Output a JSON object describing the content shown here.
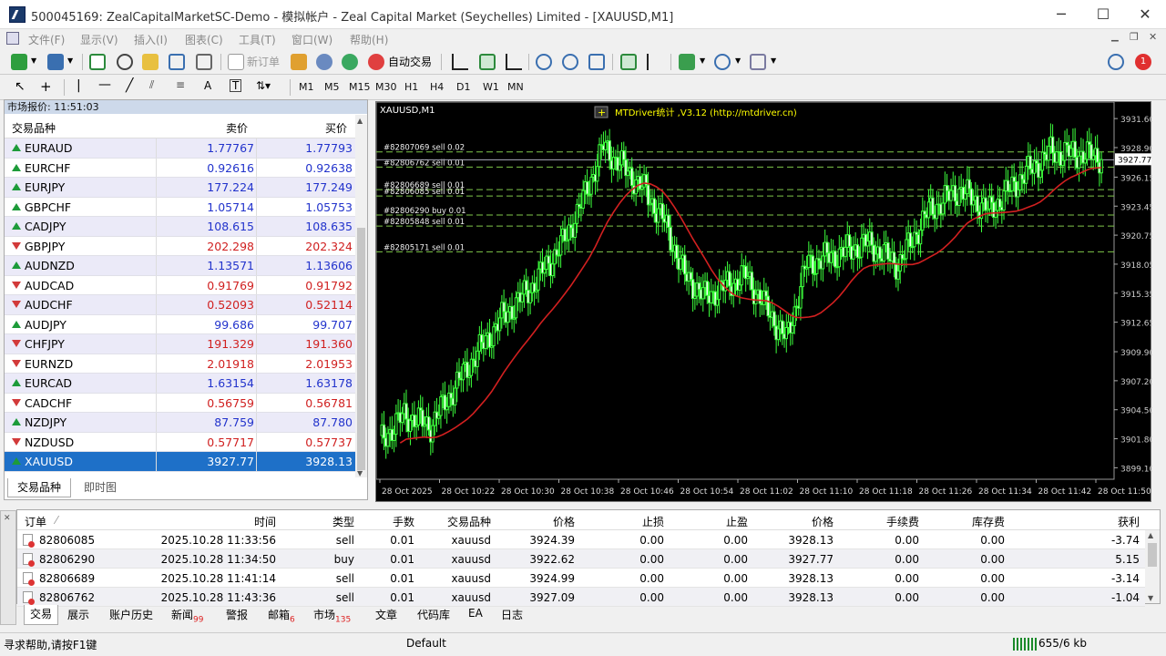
{
  "window": {
    "title": "500045169: ZealCapitalMarketSC-Demo - 模拟帐户 - Zeal Capital Market (Seychelles) Limited - [XAUUSD,M1]"
  },
  "menu": [
    "文件(F)",
    "显示(V)",
    "插入(I)",
    "图表(C)",
    "工具(T)",
    "窗口(W)",
    "帮助(H)"
  ],
  "toolbar": {
    "new_order": "新订单",
    "auto_trade": "自动交易"
  },
  "timeframes": [
    "M1",
    "M5",
    "M15",
    "M30",
    "H1",
    "H4",
    "D1",
    "W1",
    "MN"
  ],
  "market_watch": {
    "header": "市场报价: 11:51:03",
    "col_symbol": "交易品种",
    "col_bid": "卖价",
    "col_ask": "买价",
    "rows": [
      {
        "symbol": "EURAUD",
        "bid": "1.77767",
        "ask": "1.77793",
        "dir": "up"
      },
      {
        "symbol": "EURCHF",
        "bid": "0.92616",
        "ask": "0.92638",
        "dir": "up"
      },
      {
        "symbol": "EURJPY",
        "bid": "177.224",
        "ask": "177.249",
        "dir": "up"
      },
      {
        "symbol": "GBPCHF",
        "bid": "1.05714",
        "ask": "1.05753",
        "dir": "up"
      },
      {
        "symbol": "CADJPY",
        "bid": "108.615",
        "ask": "108.635",
        "dir": "up"
      },
      {
        "symbol": "GBPJPY",
        "bid": "202.298",
        "ask": "202.324",
        "dir": "down"
      },
      {
        "symbol": "AUDNZD",
        "bid": "1.13571",
        "ask": "1.13606",
        "dir": "up"
      },
      {
        "symbol": "AUDCAD",
        "bid": "0.91769",
        "ask": "0.91792",
        "dir": "down"
      },
      {
        "symbol": "AUDCHF",
        "bid": "0.52093",
        "ask": "0.52114",
        "dir": "down"
      },
      {
        "symbol": "AUDJPY",
        "bid": "99.686",
        "ask": "99.707",
        "dir": "up"
      },
      {
        "symbol": "CHFJPY",
        "bid": "191.329",
        "ask": "191.360",
        "dir": "down"
      },
      {
        "symbol": "EURNZD",
        "bid": "2.01918",
        "ask": "2.01953",
        "dir": "down"
      },
      {
        "symbol": "EURCAD",
        "bid": "1.63154",
        "ask": "1.63178",
        "dir": "up"
      },
      {
        "symbol": "CADCHF",
        "bid": "0.56759",
        "ask": "0.56781",
        "dir": "down"
      },
      {
        "symbol": "NZDJPY",
        "bid": "87.759",
        "ask": "87.780",
        "dir": "up"
      },
      {
        "symbol": "NZDUSD",
        "bid": "0.57717",
        "ask": "0.57737",
        "dir": "down"
      },
      {
        "symbol": "XAUUSD",
        "bid": "3927.77",
        "ask": "3928.13",
        "dir": "up",
        "selected": true
      }
    ],
    "tabs": [
      "交易品种",
      "即时图"
    ]
  },
  "chart": {
    "symbol_label": "XAUUSD,M1",
    "indicator_label": "MTDriver统计 ,V3.12 (http://mtdriver.cn)",
    "current_price": "3927.77",
    "price_ticks": [
      "3931.60",
      "3928.90",
      "3926.15",
      "3923.45",
      "3920.75",
      "3918.05",
      "3915.35",
      "3912.65",
      "3909.90",
      "3907.20",
      "3904.50",
      "3901.80",
      "3899.10"
    ],
    "time_ticks": [
      "28 Oct 2025",
      "28 Oct 10:22",
      "28 Oct 10:30",
      "28 Oct 10:38",
      "28 Oct 10:46",
      "28 Oct 10:54",
      "28 Oct 11:02",
      "28 Oct 11:10",
      "28 Oct 11:18",
      "28 Oct 11:26",
      "28 Oct 11:34",
      "28 Oct 11:42",
      "28 Oct 11:50"
    ],
    "order_lines": [
      {
        "label": "#82807069 sell 0.02",
        "price": 3928.5
      },
      {
        "label": "#82806762 sell 0.01",
        "price": 3927.09
      },
      {
        "label": "#82806689 sell 0.01",
        "price": 3924.99
      },
      {
        "label": "#82806085 sell 0.01",
        "price": 3924.39
      },
      {
        "label": "#82806290 buy 0.01",
        "price": 3922.62
      },
      {
        "label": "#82805848 sell 0.01",
        "price": 3921.6
      },
      {
        "label": "#82805171 sell 0.01",
        "price": 3919.2
      }
    ]
  },
  "terminal": {
    "headers": [
      "订单",
      "时间",
      "类型",
      "手数",
      "交易品种",
      "价格",
      "止损",
      "止盈",
      "价格",
      "手续费",
      "库存费",
      "获利"
    ],
    "rows": [
      [
        "82806085",
        "2025.10.28 11:33:56",
        "sell",
        "0.01",
        "xauusd",
        "3924.39",
        "0.00",
        "0.00",
        "3928.13",
        "0.00",
        "0.00",
        "-3.74"
      ],
      [
        "82806290",
        "2025.10.28 11:34:50",
        "buy",
        "0.01",
        "xauusd",
        "3922.62",
        "0.00",
        "0.00",
        "3927.77",
        "0.00",
        "0.00",
        "5.15"
      ],
      [
        "82806689",
        "2025.10.28 11:41:14",
        "sell",
        "0.01",
        "xauusd",
        "3924.99",
        "0.00",
        "0.00",
        "3928.13",
        "0.00",
        "0.00",
        "-3.14"
      ],
      [
        "82806762",
        "2025.10.28 11:43:36",
        "sell",
        "0.01",
        "xauusd",
        "3927.09",
        "0.00",
        "0.00",
        "3928.13",
        "0.00",
        "0.00",
        "-1.04"
      ]
    ],
    "tabs": [
      {
        "label": "交易",
        "badge": ""
      },
      {
        "label": "展示",
        "badge": ""
      },
      {
        "label": "账户历史",
        "badge": ""
      },
      {
        "label": "新闻",
        "badge": "99"
      },
      {
        "label": "警报",
        "badge": ""
      },
      {
        "label": "邮箱",
        "badge": "6"
      },
      {
        "label": "市场",
        "badge": "135"
      },
      {
        "label": "文章",
        "badge": ""
      },
      {
        "label": "代码库",
        "badge": ""
      },
      {
        "label": "EA",
        "badge": ""
      },
      {
        "label": "日志",
        "badge": ""
      }
    ]
  },
  "status": {
    "help": "寻求帮助,请按F1键",
    "profile": "Default",
    "traffic": "655/6 kb"
  },
  "colors": {
    "up": "#1d9b3a",
    "down": "#d23a3a",
    "blue_text": "#2233cc",
    "red_text": "#d02020",
    "selected": "#1e70c8"
  }
}
